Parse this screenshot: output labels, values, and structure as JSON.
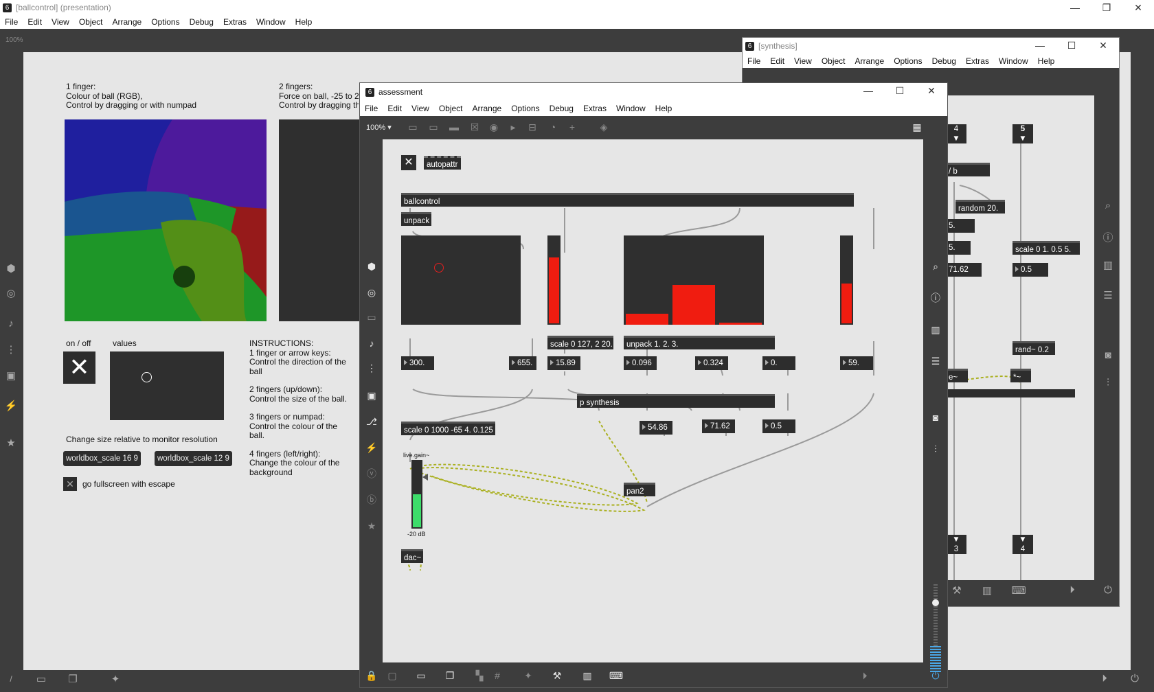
{
  "ballcontrol": {
    "title": "[ballcontrol] (presentation)",
    "menu": [
      "File",
      "Edit",
      "View",
      "Object",
      "Arrange",
      "Options",
      "Debug",
      "Extras",
      "Window",
      "Help"
    ],
    "zoom": "100%",
    "text1": [
      "1 finger:",
      "Colour of ball (RGB),",
      "Control by dragging or with numpad"
    ],
    "text2": [
      "2 fingers:",
      "Force on ball, -25 to 2",
      "Control by dragging th"
    ],
    "onoff": "on / off",
    "values": "values",
    "instructions": [
      "INSTRUCTIONS:",
      "1 finger or arrow keys:",
      "Control the direction of the",
      "ball",
      "",
      "2 fingers (up/down):",
      "Control the size of the ball.",
      "",
      "3 fingers or numpad:",
      "Control the colour of the",
      "ball.",
      "",
      "4 fingers (left/right):",
      "Change the colour of the",
      "background"
    ],
    "resize_label": "Change size relative to monitor resolution",
    "btn1": "worldbox_scale 16 9",
    "btn2": "worldbox_scale 12 9",
    "fullscreen": "go fullscreen with escape"
  },
  "synthesis": {
    "title": "[synthesis]",
    "menu": [
      "File",
      "Edit",
      "View",
      "Object",
      "Arrange",
      "Options",
      "Debug",
      "Extras",
      "Window",
      "Help"
    ],
    "objects": {
      "o4": "4",
      "o5": "5",
      "ob": "/ b",
      "random": "random 20.",
      "n5": "5.",
      "n5b": "5.",
      "scale": "scale 0 1. 0.5 5.",
      "v7162": "71.62",
      "v05": "0.5",
      "rand": "rand~ 0.2",
      "ee": "e~",
      "times": "*~",
      "out3": "3",
      "out4": "4"
    }
  },
  "assessment": {
    "title": "assessment",
    "menu": [
      "File",
      "Edit",
      "View",
      "Object",
      "Arrange",
      "Options",
      "Debug",
      "Extras",
      "Window",
      "Help"
    ],
    "zoom": "100%",
    "objects": {
      "autopattr": "autopattr",
      "ballcontrol": "ballcontrol",
      "unpack": "unpack",
      "scale127": "scale 0 127, 2 20.",
      "unpack123": "unpack 1. 2. 3.",
      "psynth": "p synthesis",
      "scale1000": "scale 0 1000 -65 4. 0.125",
      "livegain": "live.gain~",
      "db": "-20 dB",
      "dac": "dac~",
      "pan2": "pan2"
    },
    "numbers": {
      "n300": "300.",
      "n655": "655.",
      "n1589": "15.89",
      "n0096": "0.096",
      "n0324": "0.324",
      "n0": "0.",
      "n59": "59.",
      "n5486": "54.86",
      "n7162": "71.62",
      "n05": "0.5"
    },
    "multislider": [
      0.12,
      0.45,
      0.02
    ],
    "slider1_fill": 0.76,
    "slider2_fill": 0.46
  }
}
